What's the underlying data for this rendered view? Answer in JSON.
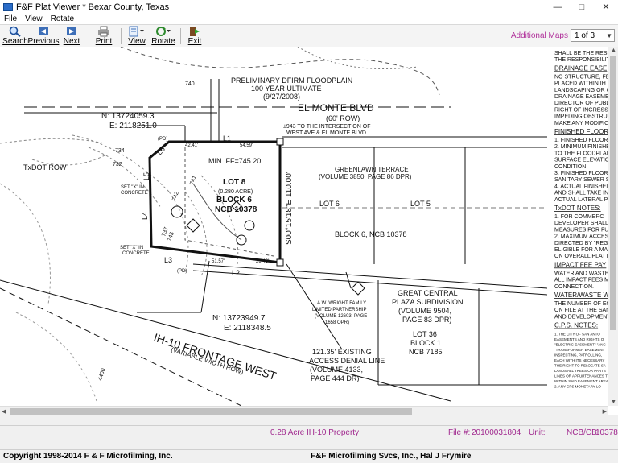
{
  "window": {
    "title": "F&F Plat Viewer * Bexar County, Texas"
  },
  "menu": [
    "File",
    "View",
    "Rotate"
  ],
  "toolbar": {
    "search": "Search",
    "previous": "Previous",
    "next": "Next",
    "print": "Print",
    "view": "View",
    "rotate": "Rotate",
    "exit": "Exit",
    "additional_maps": "Additional Maps",
    "page_value": "1 of  3"
  },
  "plat": {
    "floodplain": [
      "PRELIMINARY DFIRM FLOODPLAIN",
      "100 YEAR ULTIMATE",
      "(9/27/2008)"
    ],
    "road_name": "EL MONTE BLVD",
    "row_60": "(60' ROW)",
    "intersection": [
      "±943 TO THE INTERSECTION OF",
      "WEST AVE & EL MONTE BLVD"
    ],
    "coord_n1": "N: 13724059.3",
    "coord_e1": "E: 2118251.0",
    "txdot_row": "TxDOT ROW",
    "set_x_1": [
      "SET \"X\" IN",
      "CONCRETE"
    ],
    "set_x_2": [
      "SET \"X\" IN",
      "CONCRETE"
    ],
    "min_ff": "MIN. FF=745.20",
    "lot8": "LOT 8",
    "acre": "(0.280 ACRE)",
    "block6": "BLOCK 6",
    "ncb": "NCB 10378",
    "bearing": "S00°15'18\"E   110.00'",
    "greenlawn": [
      "GREENLAWN TERRACE",
      "(VOLUME 3850, PAGE 86 DPR)"
    ],
    "lot6": "LOT 6",
    "lot5": "LOT 5",
    "block_ncb": "BLOCK 6, NCB 10378",
    "labels_l": [
      "L1",
      "L2",
      "L3",
      "L4",
      "L5",
      "L6"
    ],
    "pd": "(PD)",
    "coord_n2": "N: 13723949.7",
    "coord_e2": "E: 2118348.5",
    "aw_wright": [
      "A.W. WRIGHT FAMILY",
      "LIMITED PARTNERSHIP",
      "(VOLUME 12603, PAGE",
      "1658 OPR)"
    ],
    "great_central": [
      "GREAT CENTRAL",
      "PLAZA SUBDIVISION",
      "(VOLUME 9504,",
      "PAGE 83 DPR)"
    ],
    "lot36": [
      "LOT 36",
      "BLOCK 1",
      "NCB 7185"
    ],
    "access_denial": [
      "121.35' EXISTING",
      "ACCESS DENIAL LINE",
      "(VOLUME 4133,",
      "PAGE 444 DR)"
    ],
    "frontage": "IH-10 FRONTAGE WEST",
    "variable_row": "(VARIABLE WIDTH ROW)",
    "dims": [
      "42.41'",
      "54.59'",
      "51.57'",
      "29.43'"
    ],
    "contours": [
      "740",
      "734",
      "732",
      "737",
      "742",
      "743",
      "741",
      "4400"
    ],
    "notes": [
      "SHALL BE THE RESPO",
      "THE RESPONSIBILITY C",
      "DRAINAGE EASE",
      "NO STRUCTURE, FEN",
      "PLACED WITHIN IH",
      "LANDSCAPING OR C",
      "DRAINAGE EASEMEN",
      "DIRECTOR OF PUBLIC",
      "RIGHT OF INGRESS A",
      "IMPEDING OBSTRUC",
      "MAKE ANY MODIFICA",
      "FINISHED FLOOR",
      "1. FINISHED FLOOR EL",
      "2. MINIMUM FINISHE",
      "TO THE FLOODPLAIN",
      "SURFACE ELEVATION",
      "CONDITION",
      "3. FINISHED FLOOR E",
      "SANITARY SEWER SER",
      "4. ACTUAL FINISHED",
      "AND SHALL TAKE INT",
      "ACTUAL LATERAL PLA",
      "TxDOT NOTES:",
      "1. FOR COMMERC",
      "DEVELOPER SHALL",
      "MEASURES FOR FUTUF",
      "2. MAXIMUM ACCES",
      "DIRECTED BY \"REGU",
      "ELIGIBLE FOR A MAX",
      "ON OVERALL PLATTE",
      "IMPACT FEE PAY",
      "WATER AND WASTEW",
      "ALL IMPACT FEES M",
      "CONNECTION.",
      "WATER/WASTE W",
      "THE NUMBER OF EQ",
      "ON FILE AT THE SAN",
      "AND DEVELOPMENT",
      "C.P.S. NOTES:",
      "1. THE CITY OF SAN ANTO",
      "EASEMENTS AND RIGHTS O",
      "\"ELECTRIC EASEMENT\" \"ANC",
      "\"TRANSFORMER EASEMENT",
      "INSPECTING, PATROLLING,",
      "EACH WITH ITS NECESSARY",
      "THE RIGHT TO RELOCATE SA",
      "LANDS ALL TREES OR PARTS",
      "LINES OR APPURTENANCES T",
      "WITHIN SAID EASEMENT AREA",
      "2. ANY CPS MONETARY LO"
    ]
  },
  "status": {
    "property": "0.28 Acre IH-10 Property",
    "file_label": "File #:",
    "file_value": "20100031804",
    "unit_label": "Unit:",
    "ncb_label": "NCB/CB:",
    "ncb_value": "10378"
  },
  "footer": {
    "copyright": "Copyright 1998-2014  F & F Microfilming, Inc.",
    "credit": "F&F Microfilming Svcs, Inc., Hal J Frymire"
  }
}
